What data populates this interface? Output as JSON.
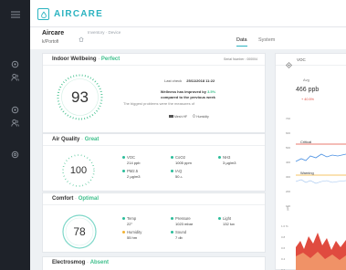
{
  "app": {
    "name": "AIRCARE"
  },
  "sidebar": {
    "items": [
      {
        "icon": "menu-icon"
      },
      {
        "icon": "location-pin-icon"
      },
      {
        "icon": "users-icon"
      },
      {
        "icon": "location-pin-icon"
      },
      {
        "icon": "users-icon"
      },
      {
        "icon": "settings-icon"
      }
    ]
  },
  "header": {
    "title": "Aircare",
    "breadcrumb": "Inventory · Device",
    "location": "k/Portofi",
    "tabs": [
      {
        "label": "Data",
        "active": true
      },
      {
        "label": "System",
        "active": false
      }
    ]
  },
  "indoor": {
    "title": "Indoor Wellbeing",
    "status": "Perfect",
    "serial": "Serial Number : 000004",
    "score": "93",
    "last_check_label": "Last check",
    "last_check_value": "25/11/2018 11:22",
    "improved_1": "Wellness has improved by ",
    "improved_pct": "3.5%",
    "improved_2": "compared to the previous week",
    "problems_text": "The biggest problems were the measures of",
    "tags": [
      "Mesh HF",
      "Humidity"
    ],
    "accent": "#3fbf8c"
  },
  "air_quality": {
    "title": "Air Quality",
    "status": "Great",
    "score": "100",
    "metrics": [
      {
        "label": "VOC",
        "value": "214 ppb"
      },
      {
        "label": "CoO2",
        "value": "1005 ppm"
      },
      {
        "label": "NH3",
        "value": "3 µg/m3"
      },
      {
        "label": "PM2.5",
        "value": "2 µg/m3"
      },
      {
        "label": "IAQ",
        "value": "50 ▵"
      }
    ]
  },
  "comfort": {
    "title": "Comfort",
    "status": "Optimal",
    "score": "78",
    "metrics": [
      {
        "label": "Temp",
        "value": "22°"
      },
      {
        "label": "Pressure",
        "value": "1023 mbar"
      },
      {
        "label": "Light",
        "value": "132 lux"
      },
      {
        "label": "Humidity",
        "value": "55 hm"
      },
      {
        "label": "Sound",
        "value": "7 db"
      }
    ],
    "humidity_color": "#f2b233"
  },
  "electrosmog": {
    "title": "Electrosmog",
    "status": "Absent"
  },
  "voc_panel": {
    "title": "VOC",
    "avg_label": "Avg",
    "avg_value": "466 ppb",
    "change": "+ 40.5%",
    "critical_label": "Critical",
    "warning_label": "Warning",
    "unit": "ppb",
    "y_ticks": [
      "700",
      "600",
      "500",
      "400",
      "300",
      "200",
      "100"
    ],
    "lower_ticks": [
      "1.0 %",
      "0.8",
      "0.6",
      "0.4",
      "0.2"
    ],
    "colors": {
      "critical": "#e04b3f",
      "warning": "#f2b233",
      "line": "#4a90e2"
    }
  }
}
